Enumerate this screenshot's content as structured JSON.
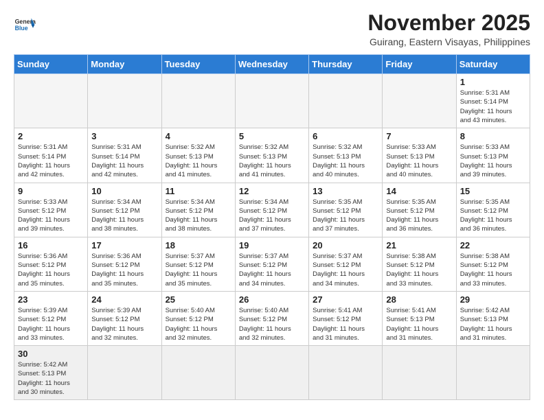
{
  "header": {
    "logo_general": "General",
    "logo_blue": "Blue",
    "month_title": "November 2025",
    "location": "Guirang, Eastern Visayas, Philippines"
  },
  "weekdays": [
    "Sunday",
    "Monday",
    "Tuesday",
    "Wednesday",
    "Thursday",
    "Friday",
    "Saturday"
  ],
  "days": [
    {
      "num": "",
      "info": ""
    },
    {
      "num": "",
      "info": ""
    },
    {
      "num": "",
      "info": ""
    },
    {
      "num": "",
      "info": ""
    },
    {
      "num": "",
      "info": ""
    },
    {
      "num": "",
      "info": ""
    },
    {
      "num": "1",
      "info": "Sunrise: 5:31 AM\nSunset: 5:14 PM\nDaylight: 11 hours\nand 43 minutes."
    },
    {
      "num": "2",
      "info": "Sunrise: 5:31 AM\nSunset: 5:14 PM\nDaylight: 11 hours\nand 42 minutes."
    },
    {
      "num": "3",
      "info": "Sunrise: 5:31 AM\nSunset: 5:14 PM\nDaylight: 11 hours\nand 42 minutes."
    },
    {
      "num": "4",
      "info": "Sunrise: 5:32 AM\nSunset: 5:13 PM\nDaylight: 11 hours\nand 41 minutes."
    },
    {
      "num": "5",
      "info": "Sunrise: 5:32 AM\nSunset: 5:13 PM\nDaylight: 11 hours\nand 41 minutes."
    },
    {
      "num": "6",
      "info": "Sunrise: 5:32 AM\nSunset: 5:13 PM\nDaylight: 11 hours\nand 40 minutes."
    },
    {
      "num": "7",
      "info": "Sunrise: 5:33 AM\nSunset: 5:13 PM\nDaylight: 11 hours\nand 40 minutes."
    },
    {
      "num": "8",
      "info": "Sunrise: 5:33 AM\nSunset: 5:13 PM\nDaylight: 11 hours\nand 39 minutes."
    },
    {
      "num": "9",
      "info": "Sunrise: 5:33 AM\nSunset: 5:12 PM\nDaylight: 11 hours\nand 39 minutes."
    },
    {
      "num": "10",
      "info": "Sunrise: 5:34 AM\nSunset: 5:12 PM\nDaylight: 11 hours\nand 38 minutes."
    },
    {
      "num": "11",
      "info": "Sunrise: 5:34 AM\nSunset: 5:12 PM\nDaylight: 11 hours\nand 38 minutes."
    },
    {
      "num": "12",
      "info": "Sunrise: 5:34 AM\nSunset: 5:12 PM\nDaylight: 11 hours\nand 37 minutes."
    },
    {
      "num": "13",
      "info": "Sunrise: 5:35 AM\nSunset: 5:12 PM\nDaylight: 11 hours\nand 37 minutes."
    },
    {
      "num": "14",
      "info": "Sunrise: 5:35 AM\nSunset: 5:12 PM\nDaylight: 11 hours\nand 36 minutes."
    },
    {
      "num": "15",
      "info": "Sunrise: 5:35 AM\nSunset: 5:12 PM\nDaylight: 11 hours\nand 36 minutes."
    },
    {
      "num": "16",
      "info": "Sunrise: 5:36 AM\nSunset: 5:12 PM\nDaylight: 11 hours\nand 35 minutes."
    },
    {
      "num": "17",
      "info": "Sunrise: 5:36 AM\nSunset: 5:12 PM\nDaylight: 11 hours\nand 35 minutes."
    },
    {
      "num": "18",
      "info": "Sunrise: 5:37 AM\nSunset: 5:12 PM\nDaylight: 11 hours\nand 35 minutes."
    },
    {
      "num": "19",
      "info": "Sunrise: 5:37 AM\nSunset: 5:12 PM\nDaylight: 11 hours\nand 34 minutes."
    },
    {
      "num": "20",
      "info": "Sunrise: 5:37 AM\nSunset: 5:12 PM\nDaylight: 11 hours\nand 34 minutes."
    },
    {
      "num": "21",
      "info": "Sunrise: 5:38 AM\nSunset: 5:12 PM\nDaylight: 11 hours\nand 33 minutes."
    },
    {
      "num": "22",
      "info": "Sunrise: 5:38 AM\nSunset: 5:12 PM\nDaylight: 11 hours\nand 33 minutes."
    },
    {
      "num": "23",
      "info": "Sunrise: 5:39 AM\nSunset: 5:12 PM\nDaylight: 11 hours\nand 33 minutes."
    },
    {
      "num": "24",
      "info": "Sunrise: 5:39 AM\nSunset: 5:12 PM\nDaylight: 11 hours\nand 32 minutes."
    },
    {
      "num": "25",
      "info": "Sunrise: 5:40 AM\nSunset: 5:12 PM\nDaylight: 11 hours\nand 32 minutes."
    },
    {
      "num": "26",
      "info": "Sunrise: 5:40 AM\nSunset: 5:12 PM\nDaylight: 11 hours\nand 32 minutes."
    },
    {
      "num": "27",
      "info": "Sunrise: 5:41 AM\nSunset: 5:12 PM\nDaylight: 11 hours\nand 31 minutes."
    },
    {
      "num": "28",
      "info": "Sunrise: 5:41 AM\nSunset: 5:13 PM\nDaylight: 11 hours\nand 31 minutes."
    },
    {
      "num": "29",
      "info": "Sunrise: 5:42 AM\nSunset: 5:13 PM\nDaylight: 11 hours\nand 31 minutes."
    },
    {
      "num": "30",
      "info": "Sunrise: 5:42 AM\nSunset: 5:13 PM\nDaylight: 11 hours\nand 30 minutes."
    }
  ]
}
